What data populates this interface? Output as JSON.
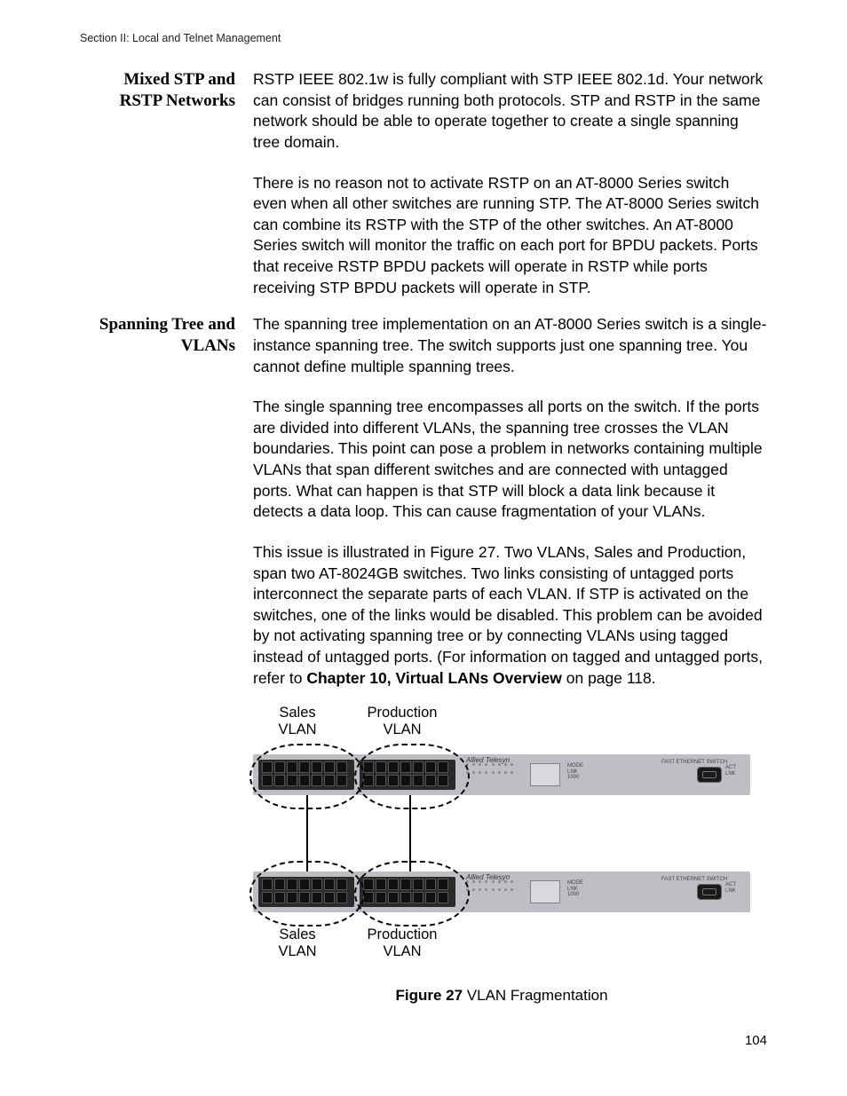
{
  "header": {
    "running": "Section II: Local and Telnet Management"
  },
  "page_number": "104",
  "sections": [
    {
      "heading": "Mixed STP and RSTP Networks",
      "paragraphs": [
        "RSTP IEEE 802.1w is fully compliant with STP IEEE 802.1d. Your network can consist of bridges running both protocols. STP and RSTP in the same network should be able to operate together to create a single spanning tree domain.",
        "There is no reason not to activate RSTP on an AT-8000 Series switch even when all other switches are running STP. The AT-8000 Series switch can combine its RSTP with the STP of the other switches. An AT-8000 Series switch will monitor the traffic on each port for BPDU packets. Ports that receive RSTP BPDU packets will operate in RSTP while ports receiving STP BPDU packets will operate in STP."
      ]
    },
    {
      "heading": "Spanning Tree and VLANs",
      "paragraphs": [
        "The spanning tree implementation on an AT-8000 Series switch is a single-instance spanning tree. The switch supports just one spanning tree. You cannot define multiple spanning trees.",
        "The single spanning tree encompasses all ports on the switch. If the ports are divided into different VLANs, the spanning tree crosses the VLAN boundaries. This point can pose a problem in networks containing multiple VLANs that span different switches and are connected with untagged ports. What can happen is that STP will block a data link because it detects a data loop. This can cause fragmentation of your VLANs."
      ],
      "ref_paragraph": {
        "pre": "This issue is illustrated in Figure 27. Two VLANs, Sales and Production, span two AT-8024GB switches. Two links consisting of untagged ports interconnect the separate parts of each VLAN. If STP is activated on the switches, one of the links would be disabled. This problem can be avoided by not activating spanning tree or by connecting VLANs using tagged instead of untagged ports. (For information on tagged and untagged ports, refer to ",
        "bold": "Chapter 10, Virtual LANs Overview",
        "post": " on page 118."
      }
    }
  ],
  "figure": {
    "labels": {
      "top_left_line1": "Sales",
      "top_left_line2": "VLAN",
      "top_right_line1": "Production",
      "top_right_line2": "VLAN",
      "bottom_left_line1": "Sales",
      "bottom_left_line2": "VLAN",
      "bottom_right_line1": "Production",
      "bottom_right_line2": "VLAN"
    },
    "brand": "Allied Telesyn",
    "caption_label": "Figure 27",
    "caption_text": "  VLAN Fragmentation"
  }
}
